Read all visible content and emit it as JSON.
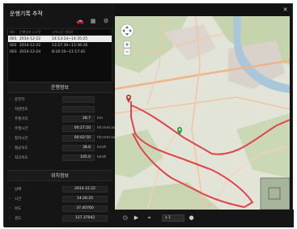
{
  "window": {
    "title": "운행기록 추적",
    "close_icon": "✕"
  },
  "toolbar": {
    "icons": [
      "car-icon",
      "print-icon",
      "gear-icon"
    ]
  },
  "list": {
    "headers": [
      "NO",
      "운행일자 (시작)",
      "시작시간 (종료)"
    ],
    "rows": [
      {
        "no": "001",
        "date": "2014-12-22",
        "time": "14:13:14~14:35:25",
        "selected": true
      },
      {
        "no": "002",
        "date": "2014-12-22",
        "time": "13:27:30~13:36:26",
        "selected": false
      },
      {
        "no": "003",
        "date": "2014-12-24",
        "time": "8:16:10~11:17:41",
        "selected": false
      }
    ]
  },
  "drive_info": {
    "title": "운행정보",
    "fields": [
      {
        "label": "운전자",
        "value": "",
        "unit": ""
      },
      {
        "label": "차량번호",
        "value": "",
        "unit": ""
      },
      {
        "label": "주행거리",
        "value": "28.7",
        "unit": "km"
      },
      {
        "label": "주행시간",
        "value": "00:27:50",
        "unit": "hh:mm:ss"
      },
      {
        "label": "정차시간",
        "value": "00:02:50",
        "unit": "hh:mm:ss"
      },
      {
        "label": "평균속도",
        "value": "38.6",
        "unit": "km/h"
      },
      {
        "label": "최고속도",
        "value": "105.0",
        "unit": "km/h"
      }
    ]
  },
  "location_info": {
    "title": "위치정보",
    "fields": [
      {
        "label": "날짜",
        "value": "2014.12.22"
      },
      {
        "label": "시간",
        "value": "14:26:25"
      },
      {
        "label": "위도",
        "value": "37.40760"
      },
      {
        "label": "경도",
        "value": "127.37042"
      }
    ]
  },
  "playback": {
    "speed": "x 1",
    "icons": [
      "clock-icon",
      "play-icon",
      "pin-icon",
      "record-icon"
    ]
  },
  "colors": {
    "route": "#e0434b",
    "road": "#f0b48a",
    "water": "#a9c6da",
    "green_area": "#c5d5ae"
  }
}
